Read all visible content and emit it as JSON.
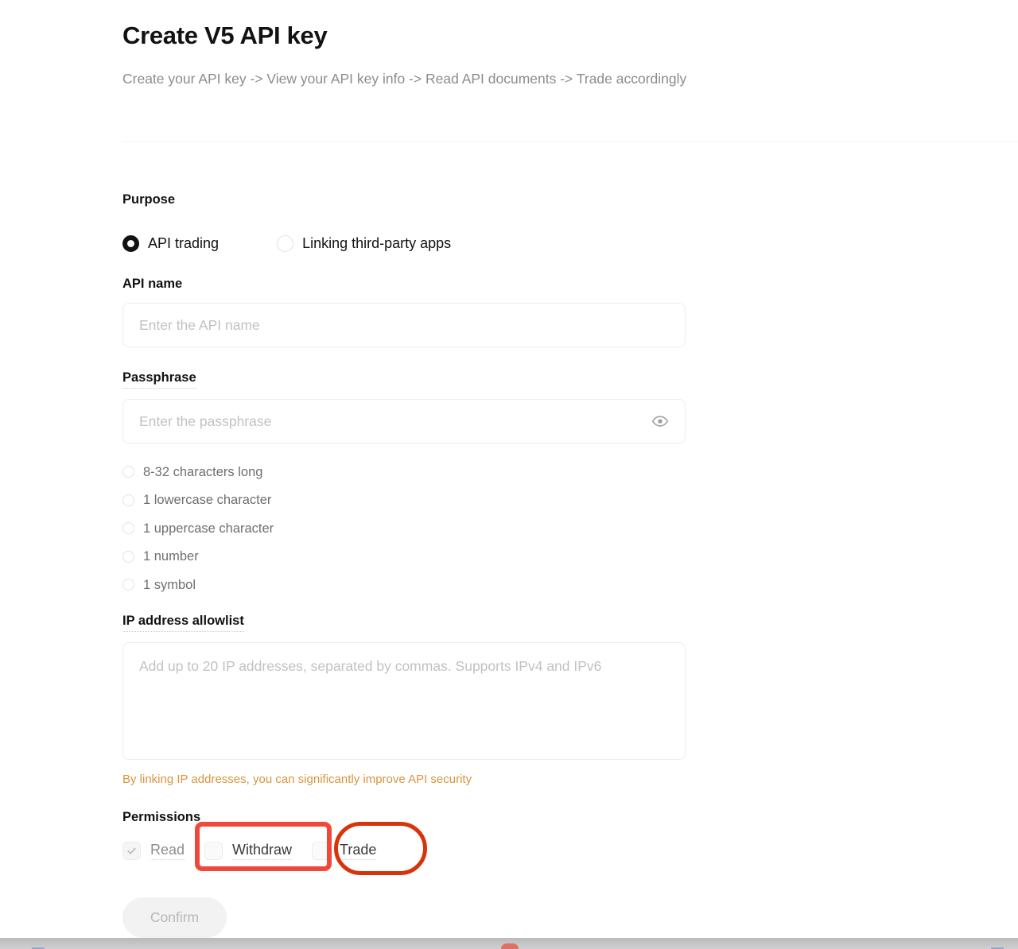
{
  "page": {
    "title": "Create V5 API key",
    "subtitle": "Create your API key -> View your API key info -> Read API documents -> Trade accordingly"
  },
  "purpose": {
    "label": "Purpose",
    "options": [
      {
        "label": "API trading",
        "selected": true
      },
      {
        "label": "Linking third-party apps",
        "selected": false
      }
    ]
  },
  "api_name": {
    "label": "API name",
    "placeholder": "Enter the API name",
    "value": ""
  },
  "passphrase": {
    "label": "Passphrase",
    "placeholder": "Enter the passphrase",
    "value": "",
    "toggle_icon": "eye-icon",
    "requirements": [
      "8-32 characters long",
      "1 lowercase character",
      "1 uppercase character",
      "1 number",
      "1 symbol"
    ]
  },
  "ip_allowlist": {
    "label": "IP address allowlist",
    "placeholder": "Add up to 20 IP addresses, separated by commas. Supports IPv4 and IPv6",
    "value": "",
    "hint": "By linking IP addresses, you can significantly improve API security"
  },
  "permissions": {
    "label": "Permissions",
    "options": [
      {
        "label": "Read",
        "checked": true,
        "disabled": true
      },
      {
        "label": "Withdraw",
        "checked": false,
        "disabled": false
      },
      {
        "label": "Trade",
        "checked": false,
        "disabled": false
      }
    ]
  },
  "actions": {
    "confirm_label": "Confirm",
    "confirm_disabled": true
  },
  "annotations": [
    {
      "shape": "rectangle",
      "target": "Withdraw",
      "color": "#f1483c"
    },
    {
      "shape": "ellipse",
      "target": "Trade",
      "color": "#d8340b"
    }
  ],
  "colors": {
    "text_primary": "#121212",
    "text_muted": "#8c8c8c",
    "placeholder": "#c2c2c2",
    "hint_orange": "#d9953c",
    "annotation_red": "#f1483c",
    "annotation_orange_red": "#d8340b",
    "border": "#eeeeee"
  }
}
